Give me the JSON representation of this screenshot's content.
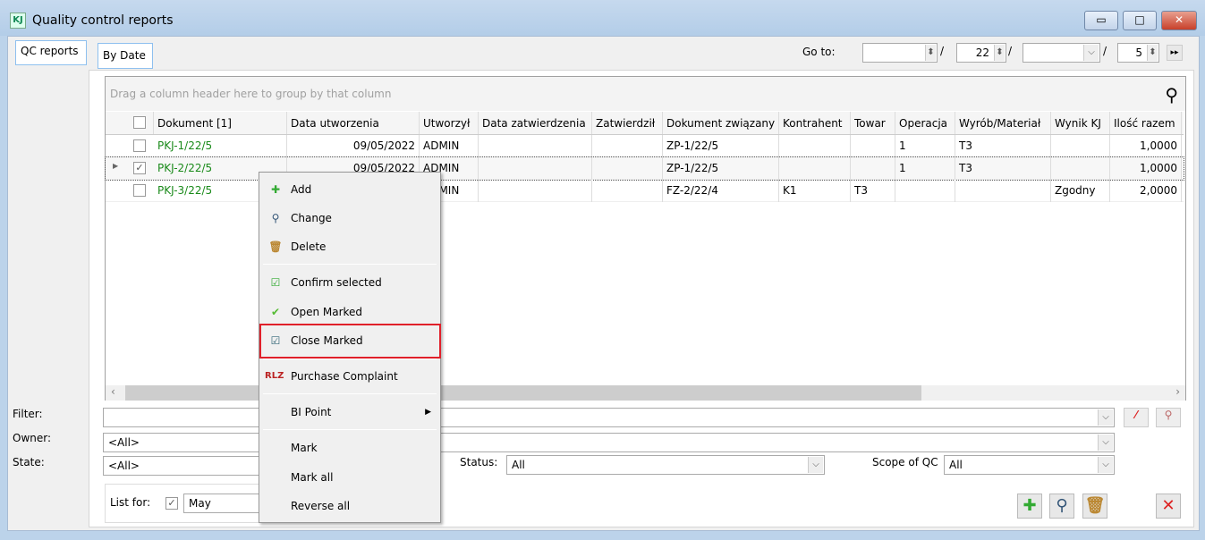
{
  "window": {
    "title": "Quality control reports",
    "icon": "KJ",
    "min": "▭",
    "max": "□",
    "close": "✕"
  },
  "tabs": {
    "left": "QC reports",
    "inner": "By Date"
  },
  "goto": {
    "label": "Go to:",
    "day": "",
    "year": "22",
    "month": "",
    "num": "5",
    "sep": "/",
    "go": "▸▸"
  },
  "grid": {
    "group_hint": "Drag a column header here to group by that column",
    "columns": [
      "Dokument [1]",
      "Data utworzenia",
      "Utworzył",
      "Data zatwierdzenia",
      "Zatwierdził",
      "Dokument związany",
      "Kontrahent",
      "Towar",
      "Operacja",
      "Wyrób/Materiał",
      "Wynik KJ",
      "Ilość razem"
    ],
    "rows": [
      [
        "PKJ-1/22/5",
        "09/05/2022",
        "ADMIN",
        "",
        "",
        "ZP-1/22/5",
        "",
        "",
        "1",
        "T3",
        "",
        "1,0000"
      ],
      [
        "PKJ-2/22/5",
        "09/05/2022",
        "ADMIN",
        "",
        "",
        "ZP-1/22/5",
        "",
        "",
        "1",
        "T3",
        "",
        "1,0000"
      ],
      [
        "PKJ-3/22/5",
        "",
        "ADMIN",
        "",
        "",
        "FZ-2/22/4",
        "K1",
        "T3",
        "",
        "",
        "Zgodny",
        "2,0000"
      ]
    ],
    "checked": [
      false,
      true,
      false
    ]
  },
  "menu": {
    "add": "Add",
    "change": "Change",
    "delete": "Delete",
    "confirm": "Confirm selected",
    "open": "Open Marked",
    "close": "Close Marked",
    "complaint": "Purchase Complaint",
    "complaint_icon": "RLZ",
    "bi": "BI Point",
    "mark": "Mark",
    "mark_all": "Mark all",
    "reverse": "Reverse all"
  },
  "filters": {
    "filter_label": "Filter:",
    "filter_value": "",
    "owner_label": "Owner:",
    "owner_value": "<All>",
    "state_label": "State:",
    "state_value": "<All>",
    "status_label": "Status:",
    "status_value": "All",
    "scope_label": "Scope of QC",
    "scope_value": "All",
    "list_for_label": "List for:",
    "list_for_value": "May",
    "list_for_checked": true
  },
  "colors": {
    "accent_green": "#1a8a1a",
    "highlight": "#e0202a"
  }
}
